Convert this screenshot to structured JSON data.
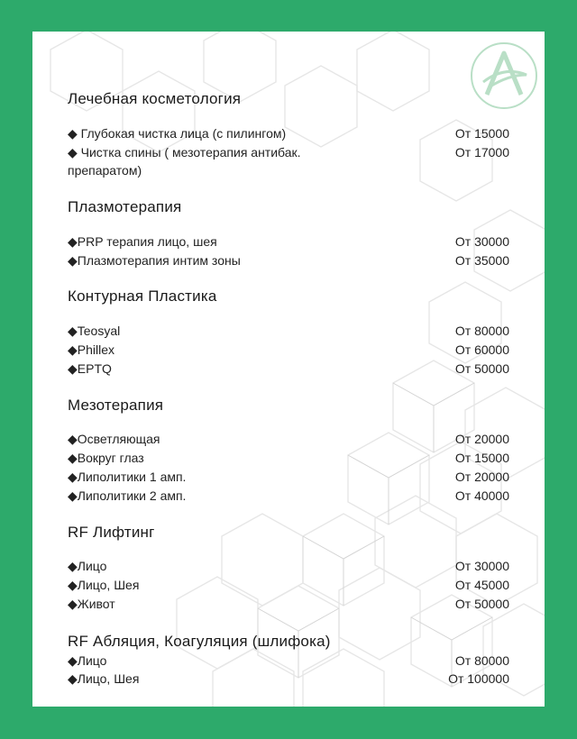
{
  "colors": {
    "frame": "#2daa6b",
    "sheet": "#ffffff",
    "logo": "#b9dfc6",
    "text": "#1f1f1f"
  },
  "logo_icon": "stylized-letter-a-logo",
  "sections": [
    {
      "title": "Лечебная косметология",
      "items": [
        {
          "name": "◆ Глубокая чистка лица (с пилингом)",
          "price": "От 15000"
        },
        {
          "name": "◆ Чистка спины ( мезотерапия антибак. препаратом)",
          "price": "От 17000"
        }
      ]
    },
    {
      "title": "Плазмотерапия",
      "items": [
        {
          "name": "◆PRP терапия лицо, шея",
          "price": "От 30000"
        },
        {
          "name": "◆Плазмотерапия интим зоны",
          "price": "От 35000"
        }
      ]
    },
    {
      "title": "Контурная Пластика",
      "items": [
        {
          "name": "◆Teosyal",
          "price": "От 80000"
        },
        {
          "name": "◆Phillex",
          "price": "От 60000"
        },
        {
          "name": "◆EPTQ",
          "price": "От 50000"
        }
      ]
    },
    {
      "title": "Мезотерапия",
      "items": [
        {
          "name": "◆Осветляющая",
          "price": "От 20000"
        },
        {
          "name": "◆Вокруг глаз",
          "price": "От 15000"
        },
        {
          "name": "◆Липолитики 1 амп.",
          "price": "От 20000"
        },
        {
          "name": "◆Липолитики 2 амп.",
          "price": "От 40000"
        }
      ]
    },
    {
      "title": "RF Лифтинг",
      "items": [
        {
          "name": "◆Лицо",
          "price": "От 30000"
        },
        {
          "name": "◆Лицо, Шея",
          "price": "От 45000"
        },
        {
          "name": "◆Живот",
          "price": "От 50000"
        }
      ]
    },
    {
      "title": "RF Абляция, Коагуляция (шлифока)",
      "items": [
        {
          "name": "◆Лицо",
          "price": "От 80000"
        },
        {
          "name": "◆Лицо, Шея",
          "price": "От 100000"
        }
      ]
    }
  ]
}
